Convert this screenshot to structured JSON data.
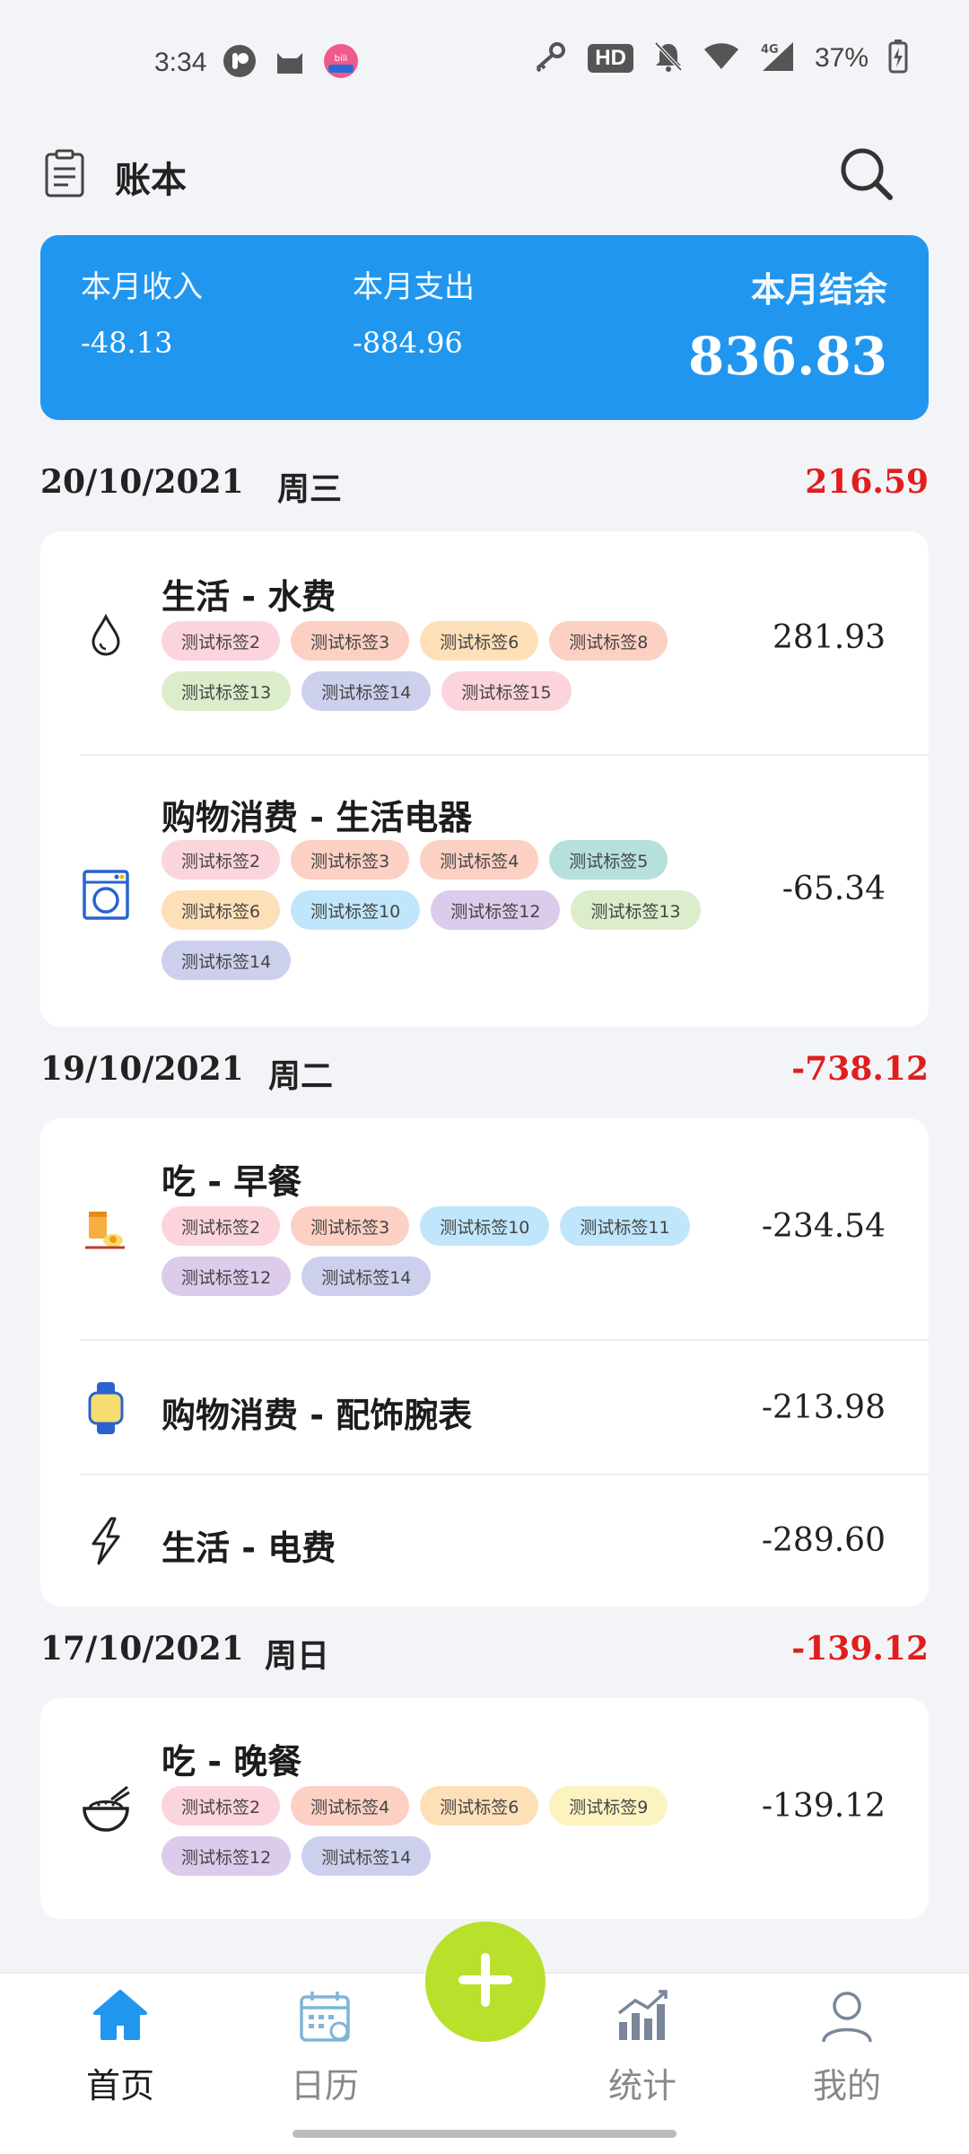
{
  "status_bar": {
    "time": "3:34",
    "battery": "37%",
    "hd_badge": "HD",
    "network": "4G"
  },
  "header": {
    "title": "账本",
    "icons": [
      "ledger-icon",
      "search-icon"
    ]
  },
  "summary": {
    "income_label": "本月收入",
    "income_value": "-48.13",
    "expense_label": "本月支出",
    "expense_value": "-884.96",
    "balance_label": "本月结余",
    "balance_value": "836.83",
    "color": "#2196ef"
  },
  "days": [
    {
      "date": "20/10/2021",
      "weekday": "周三",
      "total": "216.59",
      "entries": [
        {
          "icon": "water-drop-icon",
          "title": "生活 - 水费",
          "amount": "281.93",
          "tags": [
            "测试标签2",
            "测试标签3",
            "测试标签6",
            "测试标签8",
            "测试标签13",
            "测试标签14",
            "测试标签15"
          ]
        },
        {
          "icon": "washing-machine-icon",
          "title": "购物消费 - 生活电器",
          "amount": "-65.34",
          "tags": [
            "测试标签2",
            "测试标签3",
            "测试标签4",
            "测试标签5",
            "测试标签6",
            "测试标签10",
            "测试标签12",
            "测试标签13",
            "测试标签14"
          ]
        }
      ]
    },
    {
      "date": "19/10/2021",
      "weekday": "周二",
      "total": "-738.12",
      "entries": [
        {
          "icon": "breakfast-icon",
          "title": "吃 - 早餐",
          "amount": "-234.54",
          "tags": [
            "测试标签2",
            "测试标签3",
            "测试标签10",
            "测试标签11",
            "测试标签12",
            "测试标签14"
          ]
        },
        {
          "icon": "watch-icon",
          "title": "购物消费 - 配饰腕表",
          "amount": "-213.98",
          "tags": []
        },
        {
          "icon": "lightning-icon",
          "title": "生活 - 电费",
          "amount": "-289.60",
          "tags": []
        }
      ]
    },
    {
      "date": "17/10/2021",
      "weekday": "周日",
      "total": "-139.12",
      "entries": [
        {
          "icon": "rice-bowl-icon",
          "title": "吃 - 晚餐",
          "amount": "-139.12",
          "tags": [
            "测试标签2",
            "测试标签4",
            "测试标签6",
            "测试标签9",
            "测试标签12",
            "测试标签14"
          ]
        }
      ]
    }
  ],
  "tag_colors": {
    "测试标签2": "#fcd4dc",
    "测试标签3": "#fcd0c3",
    "测试标签4": "#fcd0c3",
    "测试标签5": "#b6e0dc",
    "测试标签6": "#fde0b8",
    "测试标签8": "#fcd0c3",
    "测试标签9": "#fdf3c0",
    "测试标签10": "#c0e6fb",
    "测试标签11": "#c0e6fb",
    "测试标签12": "#dccbeb",
    "测试标签13": "#dcedcb",
    "测试标签14": "#cdd0ec",
    "测试标签15": "#fcd4dc"
  },
  "nav": {
    "items": [
      {
        "label": "首页",
        "icon": "home-icon",
        "active": true
      },
      {
        "label": "日历",
        "icon": "calendar-icon",
        "active": false
      },
      {
        "label": "统计",
        "icon": "chart-icon",
        "active": false
      },
      {
        "label": "我的",
        "icon": "user-icon",
        "active": false
      }
    ],
    "fab_icon": "plus-icon",
    "accent": "#2196ef",
    "fab_color": "#b9e02a"
  },
  "negative_color": "#e11d1d"
}
